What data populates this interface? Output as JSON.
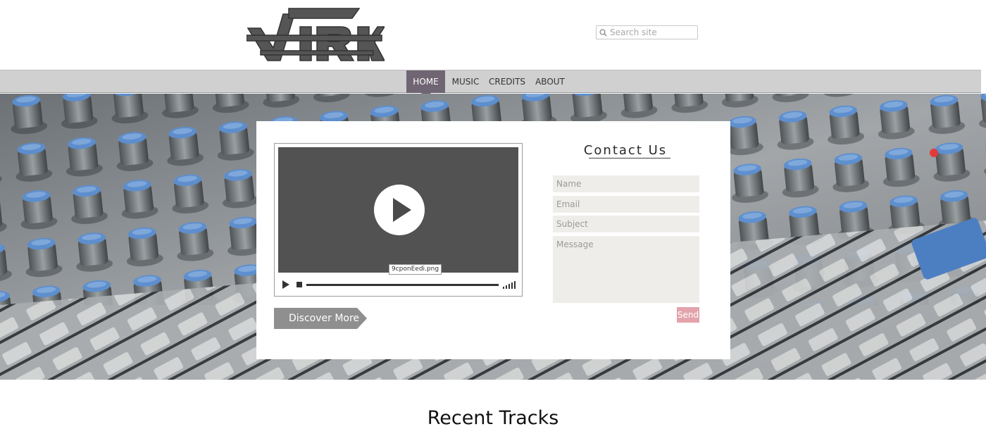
{
  "header": {
    "logo_alt": "VIRK",
    "search_placeholder": "Search site"
  },
  "nav": {
    "items": [
      {
        "label": "HOME",
        "active": true
      },
      {
        "label": "MUSIC",
        "active": false
      },
      {
        "label": "CREDITS",
        "active": false
      },
      {
        "label": "ABOUT",
        "active": false
      }
    ],
    "active_color": "#6f6573"
  },
  "video": {
    "file_label": "9cponEedi.png"
  },
  "discover": {
    "label": "Discover More"
  },
  "contact": {
    "title": "Contact Us",
    "name_placeholder": "Name",
    "email_placeholder": "Email",
    "subject_placeholder": "Subject",
    "message_placeholder": "Message",
    "send_label": "Send",
    "send_color": "#e3a3ad"
  },
  "recent": {
    "title": "Recent Tracks"
  }
}
